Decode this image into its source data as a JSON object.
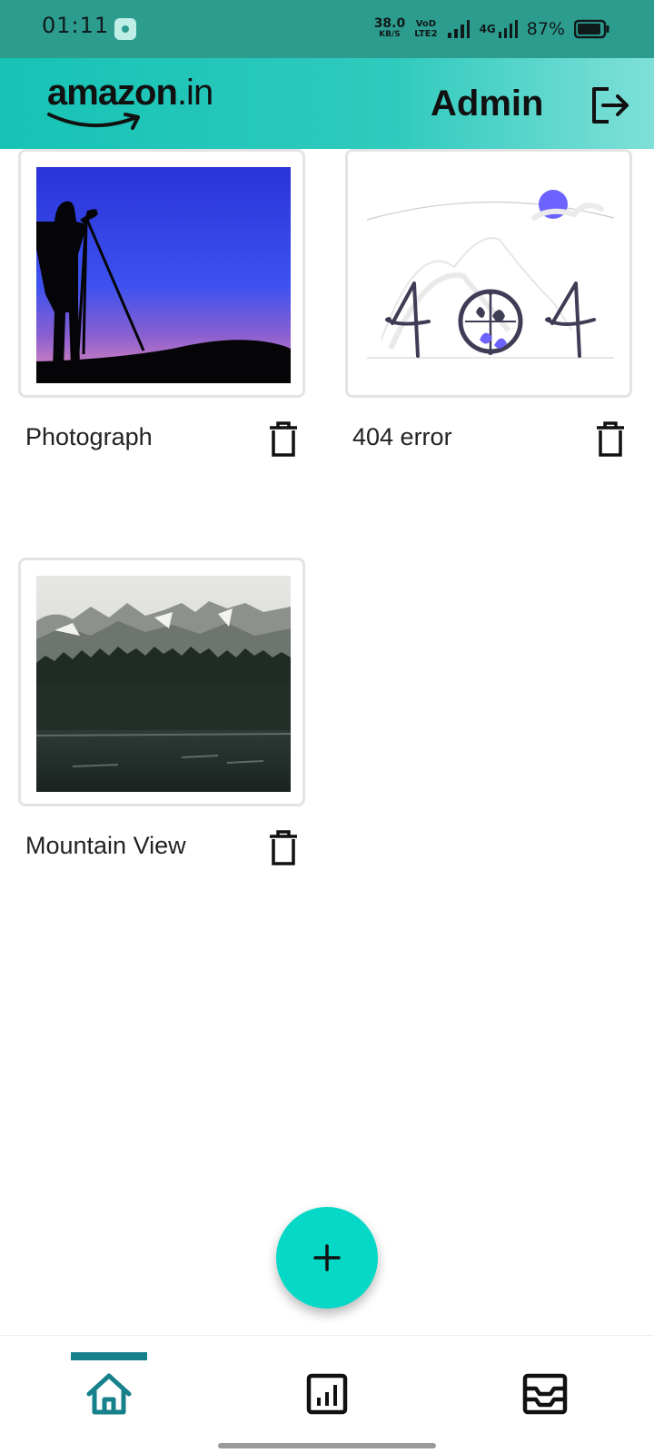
{
  "status_bar": {
    "time": "01:11",
    "net_speed_value": "38.0",
    "net_speed_unit": "KB/S",
    "volte_top": "VoD",
    "volte_bottom": "LTE2",
    "network_type": "4G",
    "battery_percent": "87%"
  },
  "header": {
    "logo_text": "amazon",
    "logo_tld": ".in",
    "title": "Admin",
    "logout_icon": "logout-icon"
  },
  "cards": [
    {
      "label": "Photograph",
      "image": "photographer-silhouette-image",
      "delete_icon": "trash-icon"
    },
    {
      "label": "404 error",
      "image": "404-illustration-image",
      "delete_icon": "trash-icon"
    },
    {
      "label": "Mountain View",
      "image": "mountain-lake-image",
      "delete_icon": "trash-icon"
    }
  ],
  "fab": {
    "icon": "plus-icon"
  },
  "bottom_nav": {
    "items": [
      {
        "icon": "home-icon",
        "active": true
      },
      {
        "icon": "chart-icon",
        "active": false
      },
      {
        "icon": "inbox-icon",
        "active": false
      }
    ]
  },
  "colors": {
    "header_gradient_start": "#16c3b5",
    "status_bar": "#2c9c8f",
    "fab": "#05d8c6",
    "active_nav": "#16808b"
  }
}
